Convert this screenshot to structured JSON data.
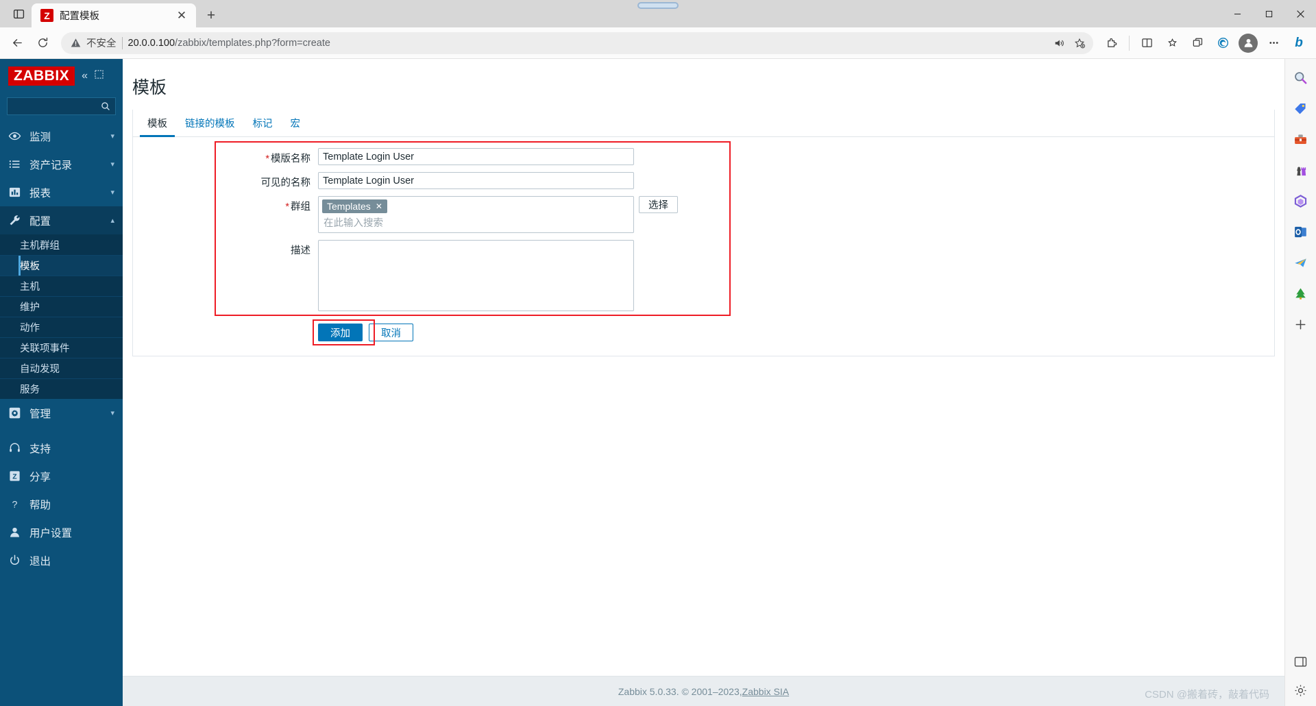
{
  "browser": {
    "tab": {
      "title": "配置模板",
      "favicon_letter": "Z",
      "close_label": "✕"
    },
    "newtab_label": "+",
    "tab_overview_icon": "tab-overview-icon",
    "window_controls": {
      "minimize": "minimize-icon",
      "maximize": "maximize-icon",
      "close": "close-icon"
    },
    "nav": {
      "back": "back-arrow-icon",
      "refresh": "refresh-icon",
      "security_label": "不安全",
      "url_host": "20.0.0.100",
      "url_path": "/zabbix/templates.php?form=create",
      "read_aloud": "read-aloud-icon",
      "favorite": "add-favorite-icon",
      "extensions": "extensions-icon",
      "split_screen": "split-screen-icon",
      "collections": "collections-icon",
      "browser_essentials": "browser-essentials-icon",
      "edge_profile": "edge-icon",
      "profile": "profile-avatar-icon",
      "settings_more": "more-options-icon",
      "copilot": "bing-copilot-icon"
    }
  },
  "sidebar": {
    "logo": "ZABBIX",
    "collapse_icon": "collapse-sidebar-icon",
    "expand_icon": "expand-sidebar-icon",
    "search_placeholder": "",
    "search_value": "",
    "search_icon": "search-icon",
    "menu": [
      {
        "label": "监测",
        "icon": "eye-icon",
        "expanded": false,
        "active": false
      },
      {
        "label": "资产记录",
        "icon": "list-icon",
        "expanded": false,
        "active": false
      },
      {
        "label": "报表",
        "icon": "bar-chart-icon",
        "expanded": false,
        "active": false
      },
      {
        "label": "配置",
        "icon": "wrench-icon",
        "expanded": true,
        "active": true
      }
    ],
    "submenu": [
      {
        "label": "主机群组",
        "active": false
      },
      {
        "label": "模板",
        "active": true
      },
      {
        "label": "主机",
        "active": false
      },
      {
        "label": "维护",
        "active": false
      },
      {
        "label": "动作",
        "active": false
      },
      {
        "label": "关联项事件",
        "active": false
      },
      {
        "label": "自动发现",
        "active": false
      },
      {
        "label": "服务",
        "active": false
      }
    ],
    "admin": {
      "label": "管理",
      "icon": "gear-icon"
    },
    "bottom": [
      {
        "label": "支持",
        "icon": "headset-icon"
      },
      {
        "label": "分享",
        "icon": "zabbix-share-icon"
      },
      {
        "label": "帮助",
        "icon": "question-mark-icon"
      },
      {
        "label": "用户设置",
        "icon": "user-icon"
      },
      {
        "label": "退出",
        "icon": "power-icon"
      }
    ]
  },
  "page": {
    "title": "模板",
    "tabs": [
      {
        "label": "模板",
        "active": true
      },
      {
        "label": "链接的模板",
        "active": false
      },
      {
        "label": "标记",
        "active": false
      },
      {
        "label": "宏",
        "active": false
      }
    ]
  },
  "form": {
    "template_name": {
      "label": "模版名称",
      "required": true,
      "value": "Template Login User"
    },
    "visible_name": {
      "label": "可见的名称",
      "required": false,
      "value": "Template Login User"
    },
    "groups": {
      "label": "群组",
      "required": true,
      "chips": [
        {
          "text": "Templates",
          "remove": "✕"
        }
      ],
      "placeholder": "在此输入搜索",
      "select_button": "选择"
    },
    "description": {
      "label": "描述",
      "required": false,
      "value": "",
      "placeholder": ""
    },
    "buttons": {
      "submit": "添加",
      "cancel": "取消"
    }
  },
  "footer": {
    "text": "Zabbix 5.0.33. © 2001–2023, ",
    "link": "Zabbix SIA",
    "watermark": "CSDN @搬着砖，敲着代码"
  },
  "rail": [
    {
      "name": "search-icon"
    },
    {
      "name": "shopping-tag-icon"
    },
    {
      "name": "toolbox-icon"
    },
    {
      "name": "games-icon"
    },
    {
      "name": "office-icon"
    },
    {
      "name": "outlook-icon"
    },
    {
      "name": "telegram-icon"
    },
    {
      "name": "tree-icon"
    },
    {
      "name": "add-icon"
    }
  ],
  "rail_bottom": [
    {
      "name": "sidebar-pane-icon"
    },
    {
      "name": "settings-gear-icon"
    }
  ],
  "colors": {
    "zabbix_blue": "#0c5179",
    "zabbix_red": "#d40000",
    "accent": "#0275b8",
    "highlight_red": "#ee1c25"
  }
}
